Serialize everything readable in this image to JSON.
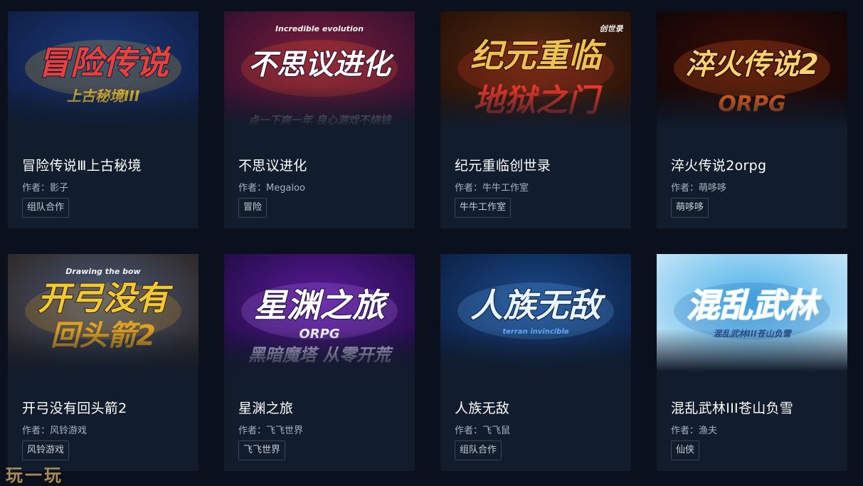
{
  "author_prefix": "作者：",
  "watermark": "玩一玩",
  "games": [
    {
      "title": "冒险传说Ⅲ上古秘境",
      "author": "影子",
      "tag": "组队合作",
      "cover_logo": "冒险传说",
      "cover_sub": "上古秘境III",
      "cover_extra": "",
      "colors": {
        "bg1": "#1b3a7a",
        "bg2": "#0d1a3d",
        "accent": "#f2c12e",
        "logo": "#e8403b"
      }
    },
    {
      "title": "不思议进化",
      "author": "Megaloo",
      "tag": "冒险",
      "cover_logo": "不思议进化",
      "cover_sub": "点一下爽一年 良心游戏不烧钱",
      "cover_extra": "Incredible evolution",
      "colors": {
        "bg1": "#7a1e3a",
        "bg2": "#2a0d2e",
        "accent": "#ff5a2a",
        "logo": "#ffffff"
      }
    },
    {
      "title": "纪元重临创世录",
      "author": "牛牛工作室",
      "tag": "牛牛工作室",
      "cover_logo": "纪元重临",
      "cover_sub": "地狱之门",
      "cover_extra": "创世录",
      "colors": {
        "bg1": "#5a2a10",
        "bg2": "#1e0d06",
        "accent": "#e8382a",
        "logo": "#f0c050"
      }
    },
    {
      "title": "淬火传说2orpg",
      "author": "萌哆哆",
      "tag": "萌哆哆",
      "cover_logo": "淬火传说2",
      "cover_sub": "ORPG",
      "cover_extra": "",
      "colors": {
        "bg1": "#3a0e08",
        "bg2": "#0a0406",
        "accent": "#ff6a1a",
        "logo": "#ffd070"
      }
    },
    {
      "title": "开弓没有回头箭2",
      "author": "风铃游戏",
      "tag": "风铃游戏",
      "cover_logo": "开弓没有",
      "cover_sub": "回头箭2",
      "cover_extra": "Drawing the bow",
      "colors": {
        "bg1": "#4a5a7a",
        "bg2": "#2a2018",
        "accent": "#e0a020",
        "logo": "#f4c830"
      }
    },
    {
      "title": "星渊之旅",
      "author": "飞飞世界",
      "tag": "飞飞世界",
      "cover_logo": "星渊之旅",
      "cover_sub": "黑暗魔塔 从零开荒",
      "cover_extra": "ORPG",
      "colors": {
        "bg1": "#5a1a9a",
        "bg2": "#1a0a3a",
        "accent": "#c080ff",
        "logo": "#ffffff"
      }
    },
    {
      "title": "人族无敌",
      "author": "飞飞鼠",
      "tag": "组队合作",
      "cover_logo": "人族无敌",
      "cover_sub": "terran invincible",
      "cover_extra": "",
      "colors": {
        "bg1": "#1a4a8a",
        "bg2": "#0a1a3a",
        "accent": "#6ab0ff",
        "logo": "#e8f4ff"
      }
    },
    {
      "title": "混乱武林III苍山负雪",
      "author": "渔夫",
      "tag": "仙侠",
      "cover_logo": "混乱武林",
      "cover_sub": "混乱武林III苍山负雪",
      "cover_extra": "",
      "colors": {
        "bg1": "#4ab0e8",
        "bg2": "#d8eefa",
        "accent": "#1a60b0",
        "logo": "#ffffff"
      }
    }
  ]
}
